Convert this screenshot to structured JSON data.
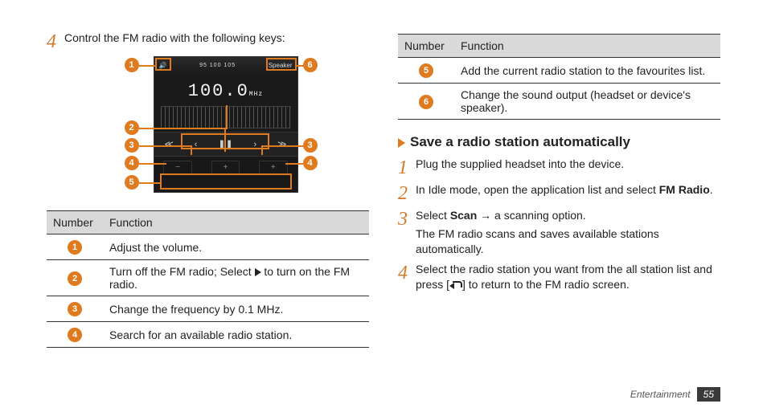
{
  "left": {
    "step4_num": "4",
    "step4_text": "Control the FM radio with the following keys:",
    "radio": {
      "freq_presets": "95    100    105",
      "speaker_label": "Speaker",
      "freq_display": "100.0",
      "mhz": "MHz",
      "controls": {
        "rw": "≪",
        "prev": "‹",
        "play": "❚❚",
        "next": "›",
        "ff": "≫"
      },
      "bottom": {
        "minus": "−",
        "plus": "+",
        "plus2": "+"
      }
    },
    "callouts": {
      "n1": "1",
      "n2": "2",
      "n3": "3",
      "n4": "4",
      "n5": "5",
      "n6": "6"
    },
    "table_head_num": "Number",
    "table_head_func": "Function",
    "table": [
      {
        "n": "1",
        "f": "Adjust the volume."
      },
      {
        "n": "2",
        "f": "Turn off the FM radio; Select ▶ to turn on the FM radio."
      },
      {
        "n": "3",
        "f": "Change the frequency by 0.1 MHz."
      },
      {
        "n": "4",
        "f": "Search for an available radio station."
      }
    ]
  },
  "right": {
    "table_head_num": "Number",
    "table_head_func": "Function",
    "table": [
      {
        "n": "5",
        "f": "Add the current radio station to the favourites list."
      },
      {
        "n": "6",
        "f": "Change the sound output (headset or device's speaker)."
      }
    ],
    "section_title": "Save a radio station automatically",
    "steps": {
      "s1_num": "1",
      "s1": "Plug the supplied headset into the device.",
      "s2_num": "2",
      "s2_pre": "In Idle mode, open the application list and select ",
      "s2_bold": "FM Radio",
      "s2_post": ".",
      "s3_num": "3",
      "s3_pre": "Select ",
      "s3_bold": "Scan",
      "s3_post": " → a scanning option.",
      "s3_sub": "The FM radio scans and saves available stations automatically.",
      "s4_num": "4",
      "s4_pre": "Select the radio station you want from the all station list and press [",
      "s4_post": "] to return to the FM radio screen."
    }
  },
  "footer": {
    "section": "Entertainment",
    "page": "55"
  }
}
